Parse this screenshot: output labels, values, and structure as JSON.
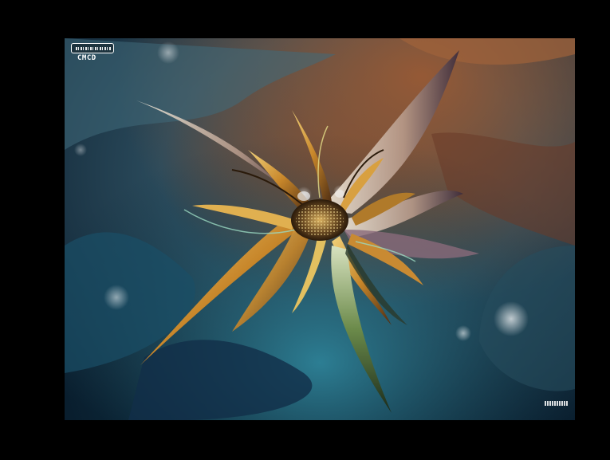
{
  "artwork": {
    "logo_text": "CMCD",
    "colors": {
      "background_dark": "#0c2436",
      "water_teal": "#2a7d8c",
      "earth_brown": "#7a4a2a",
      "petal_gold": "#d6a13a",
      "petal_pale": "#e8dfc8",
      "center_dark": "#3a2a18"
    }
  }
}
